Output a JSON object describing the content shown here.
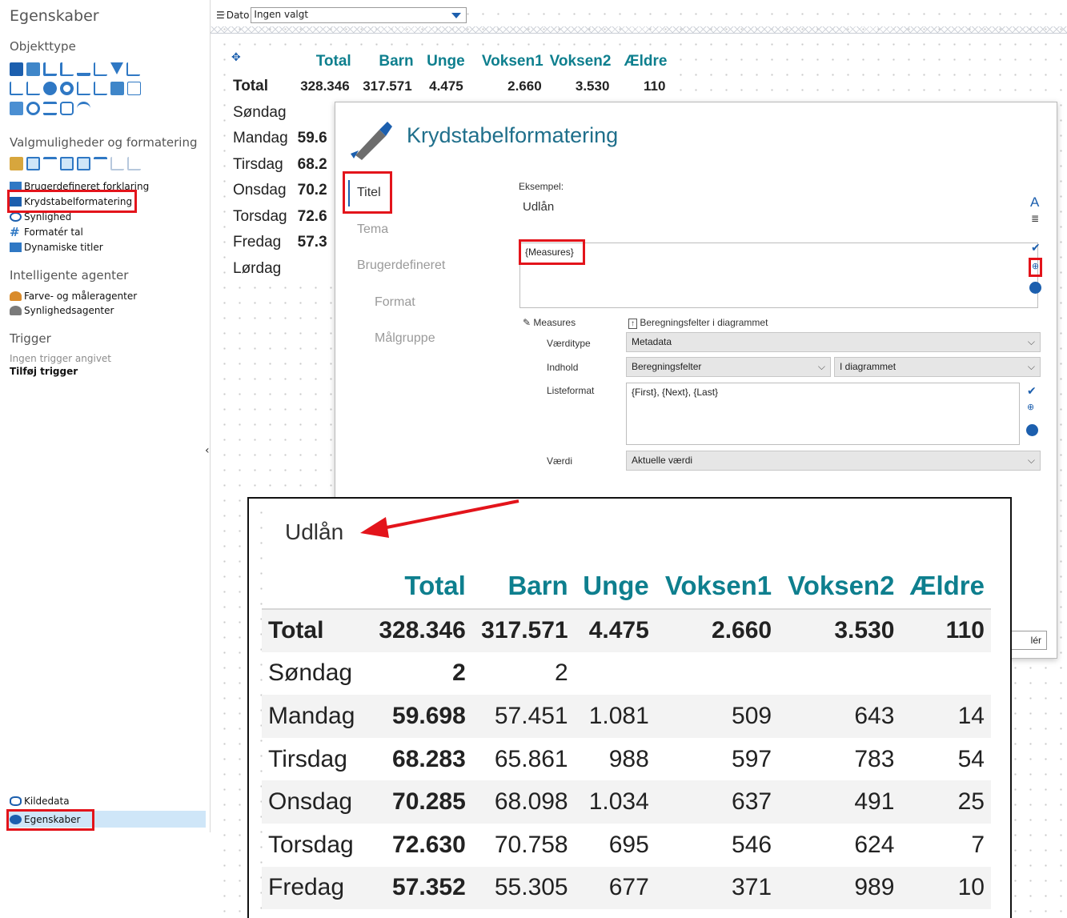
{
  "sidebar": {
    "title": "Egenskaber",
    "object_type_heading": "Objekttype",
    "options_heading": "Valgmuligheder og formatering",
    "options_links": [
      "Brugerdefineret forklaring",
      "Krydstabelformatering",
      "Synlighed",
      "Formatér tal",
      "Dynamiske titler"
    ],
    "agents_heading": "Intelligente agenter",
    "agents_links": [
      "Farve- og måleragenter",
      "Synlighedsagenter"
    ],
    "trigger_heading": "Trigger",
    "trigger_none": "Ingen trigger angivet",
    "trigger_add": "Tilføj trigger",
    "bottom_links": [
      "Kildedata",
      "Egenskaber"
    ]
  },
  "filter": {
    "label": "Dato",
    "value": "Ingen valgt"
  },
  "crosstab": {
    "columns": [
      "Total",
      "Barn",
      "Unge",
      "Voksen1",
      "Voksen2",
      "Ældre"
    ],
    "rows": [
      {
        "label": "Total",
        "values": [
          "328.346",
          "317.571",
          "4.475",
          "2.660",
          "3.530",
          "110"
        ]
      },
      {
        "label": "Søndag",
        "values": [
          "2",
          "2",
          "",
          "",
          "",
          ""
        ]
      },
      {
        "label": "Mandag",
        "values": [
          "59.698",
          "57.451",
          "1.081",
          "509",
          "643",
          "14"
        ]
      },
      {
        "label": "Tirsdag",
        "values": [
          "68.283",
          "65.861",
          "988",
          "597",
          "783",
          "54"
        ]
      },
      {
        "label": "Onsdag",
        "values": [
          "70.285",
          "68.098",
          "1.034",
          "637",
          "491",
          "25"
        ]
      },
      {
        "label": "Torsdag",
        "values": [
          "72.630",
          "70.758",
          "695",
          "546",
          "624",
          "7"
        ]
      },
      {
        "label": "Fredag",
        "values": [
          "57.352",
          "55.305",
          "677",
          "371",
          "989",
          "10"
        ]
      },
      {
        "label": "Lørdag",
        "values": [
          "",
          "",
          "",
          "",
          "",
          ""
        ]
      }
    ],
    "bg_partial_totals": [
      "59.6",
      "68.2",
      "70.2",
      "72.6",
      "57.3"
    ]
  },
  "dialog": {
    "title": "Krydstabelformatering",
    "nav": [
      "Titel",
      "Tema",
      "Brugerdefineret",
      "Format",
      "Målgruppe"
    ],
    "example_label": "Eksempel:",
    "example_value": "Udlån",
    "title_expression": "{Measures}",
    "measures_label": "Measures",
    "calc_fields_label": "Beregningsfelter i diagrammet",
    "value_type_label": "Værditype",
    "value_type": "Metadata",
    "content_label": "Indhold",
    "content_value": "Beregningsfelter",
    "content_scope": "I diagrammet",
    "list_format_label": "Listeformat",
    "list_format": "{First}, {Next}, {Last}",
    "value_label": "Værdi",
    "value_value": "Aktuelle værdi",
    "apply_button_partial": "lér"
  },
  "zoom": {
    "title": "Udlån"
  },
  "colors": {
    "accent": "#0e7f8e",
    "title_blue": "#1f6f8b",
    "highlight": "#e3141b",
    "selection": "#cfe6f8"
  }
}
